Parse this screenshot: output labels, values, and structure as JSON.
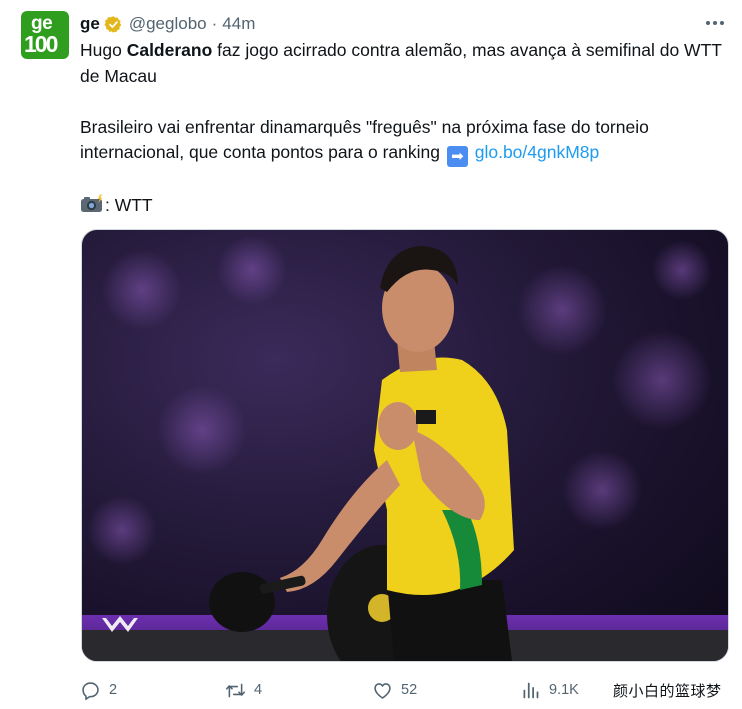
{
  "author": {
    "avatar_top": "ge",
    "avatar_bottom": "100",
    "name": "ge",
    "handle": "@geglobo",
    "separator": "·",
    "time": "44m"
  },
  "tweet": {
    "line1_pre": "Hugo ",
    "line1_bold": "Calderano",
    "line1_post": " faz jogo acirrado contra alemão, mas avança à semifinal do WTT de Macau",
    "line2": "Brasileiro vai enfrentar dinamarquês \"freguês\" na próxima fase do torneio internacional, que conta pontos para o ranking",
    "arrow": "➡",
    "link": "glo.bo/4gnkM8p",
    "credit": ": WTT"
  },
  "actions": {
    "replies": "2",
    "retweets": "4",
    "likes": "52",
    "views": "9.1K"
  },
  "watermark": "颜小白的篮球梦",
  "icons": {
    "verified": "verified-badge-icon",
    "more": "more-dots-icon",
    "reply": "reply-icon",
    "retweet": "retweet-icon",
    "like": "heart-icon",
    "views": "views-chart-icon",
    "camera": "camera-flash-emoji",
    "arrow": "right-arrow-emoji"
  },
  "colors": {
    "link": "#1d9bf0",
    "secondary_text": "#536471",
    "brand_green": "#2f9e1f",
    "verified_gold": "#e2b719"
  }
}
